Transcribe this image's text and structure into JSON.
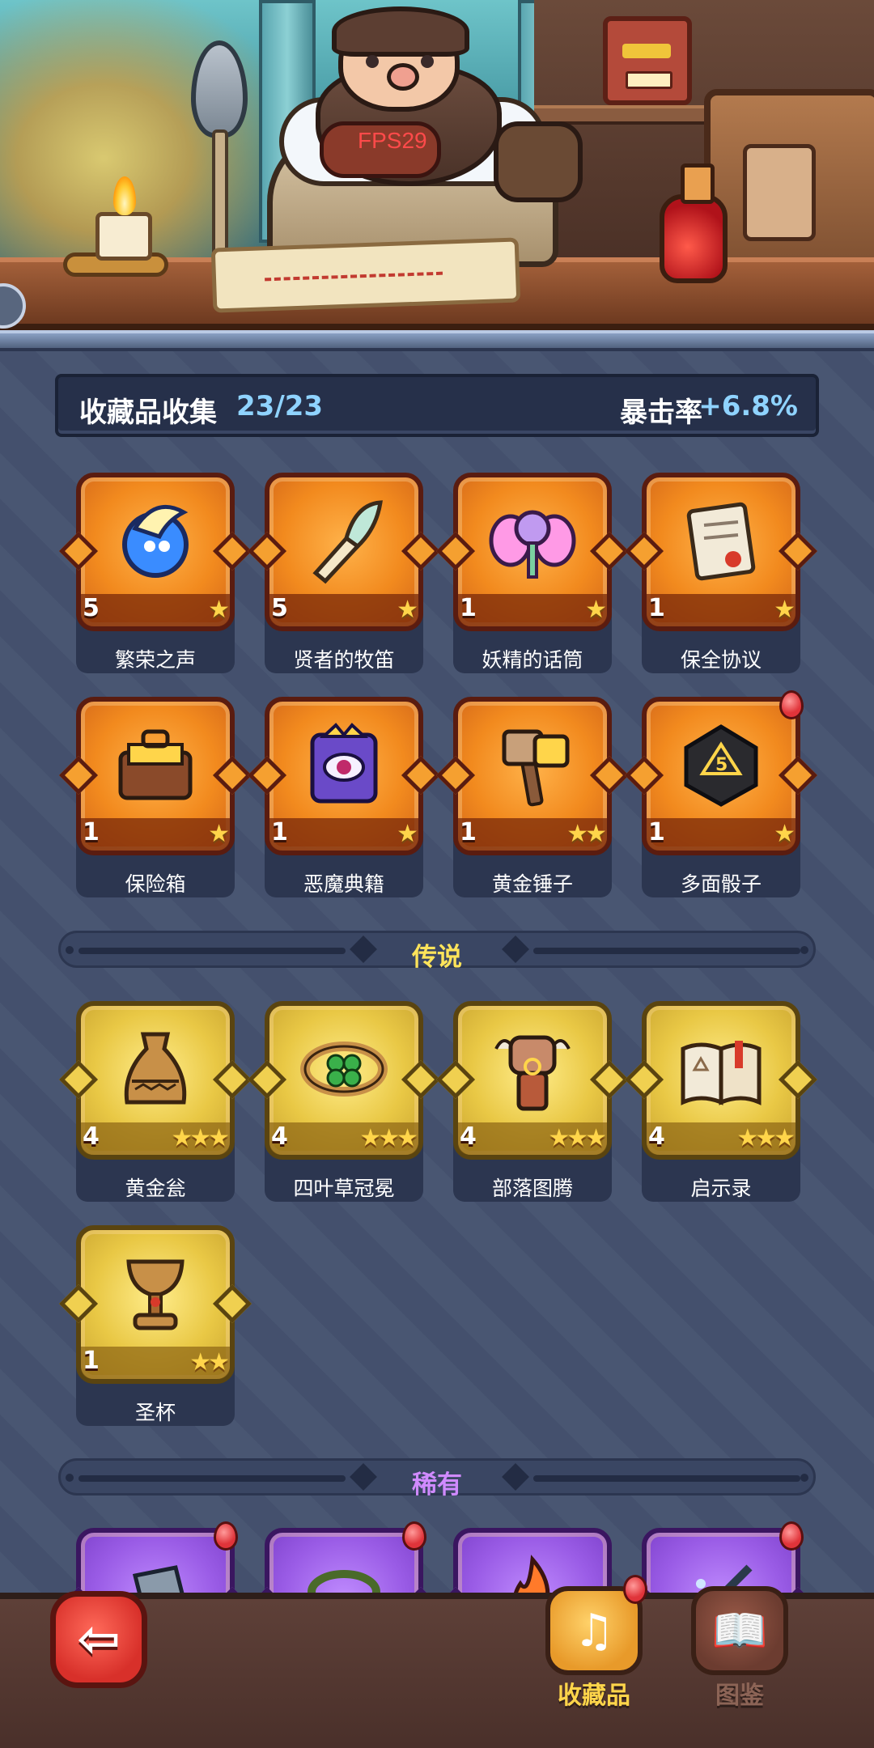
{
  "hud": {
    "fps": "FPS29"
  },
  "summary": {
    "title": "收藏品收集",
    "count": "23/23",
    "crit_label": "暴击率",
    "crit_value": "+6.8%"
  },
  "colors": {
    "epic": "#f28a1e",
    "legendary": "#e9c845",
    "rare": "#9a5ce6",
    "accent_blue": "#8fd3ff",
    "badge_red": "#e0343a"
  },
  "epic_items": [
    {
      "name": "繁荣之声",
      "level": "5",
      "stars": "★",
      "icon": "spirit-orb-icon",
      "glyph": "💧",
      "new": false
    },
    {
      "name": "贤者的牧笛",
      "level": "5",
      "stars": "★",
      "icon": "feather-flute-icon",
      "glyph": "🪶",
      "new": false
    },
    {
      "name": "妖精的话筒",
      "level": "1",
      "stars": "★",
      "icon": "fairy-microphone-icon",
      "glyph": "🎤",
      "new": false
    },
    {
      "name": "保全协议",
      "level": "1",
      "stars": "★",
      "icon": "contract-scroll-icon",
      "glyph": "📜",
      "new": false
    },
    {
      "name": "保险箱",
      "level": "1",
      "stars": "★",
      "icon": "treasure-chest-icon",
      "glyph": "🧰",
      "new": false
    },
    {
      "name": "恶魔典籍",
      "level": "1",
      "stars": "★",
      "icon": "demon-book-icon",
      "glyph": "👁",
      "new": false
    },
    {
      "name": "黄金锤子",
      "level": "1",
      "stars": "★★",
      "icon": "golden-hammer-icon",
      "glyph": "🔨",
      "new": false
    },
    {
      "name": "多面骰子",
      "level": "1",
      "stars": "★",
      "icon": "polyhedral-dice-icon",
      "glyph": "🎲",
      "new": true
    }
  ],
  "sections": {
    "legendary": "传说",
    "rare": "稀有"
  },
  "legendary_items": [
    {
      "name": "黄金瓮",
      "level": "4",
      "stars": "★★★",
      "icon": "golden-urn-icon",
      "glyph": "🏺"
    },
    {
      "name": "四叶草冠冕",
      "level": "4",
      "stars": "★★★",
      "icon": "clover-crown-icon",
      "glyph": "🍀"
    },
    {
      "name": "部落图腾",
      "level": "4",
      "stars": "★★★",
      "icon": "tribal-totem-icon",
      "glyph": "🗿"
    },
    {
      "name": "启示录",
      "level": "4",
      "stars": "★★★",
      "icon": "revelation-book-icon",
      "glyph": "📖"
    },
    {
      "name": "圣杯",
      "level": "1",
      "stars": "★★",
      "icon": "holy-grail-icon",
      "glyph": "🏆"
    }
  ],
  "rare_items": [
    {
      "icon": "rare-item-1-icon",
      "glyph": "🪓",
      "new": true
    },
    {
      "icon": "rare-item-2-icon",
      "glyph": "🌿",
      "new": true
    },
    {
      "icon": "rare-item-3-icon",
      "glyph": "🔥",
      "new": false
    },
    {
      "icon": "rare-item-4-icon",
      "glyph": "🗡",
      "new": true
    }
  ],
  "bottom_nav": {
    "back_icon": "back-arrow-icon",
    "collection_label": "收藏品",
    "collection_icon": "lyre-icon",
    "codex_label": "图鉴",
    "codex_icon": "book-icon"
  }
}
